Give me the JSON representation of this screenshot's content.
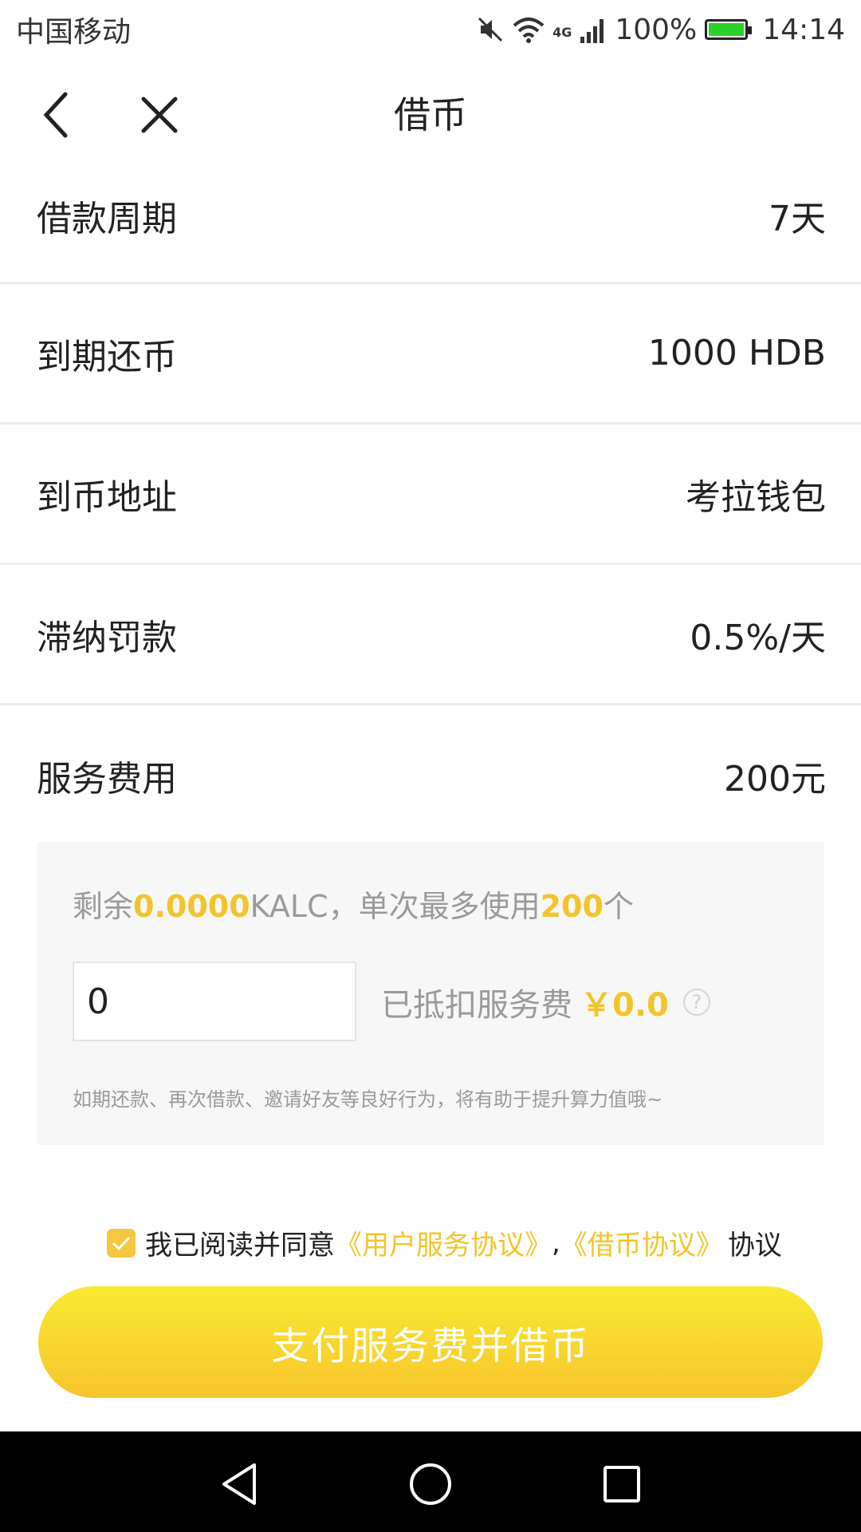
{
  "status_bar": {
    "carrier": "中国移动",
    "network": "4G",
    "battery": "100%",
    "time": "14:14",
    "icons": [
      "mute-icon",
      "wifi-icon",
      "signal-icon",
      "battery-icon"
    ],
    "battery_color": "#2bd12b"
  },
  "nav": {
    "title": "借币",
    "icons": [
      "back-icon",
      "close-icon"
    ]
  },
  "rows": [
    {
      "label": "借款周期",
      "value": "7天"
    },
    {
      "label": "到期还币",
      "value": "1000 HDB"
    },
    {
      "label": "到币地址",
      "value": "考拉钱包"
    },
    {
      "label": "滞纳罚款",
      "value": "0.5%/天"
    },
    {
      "label": "服务费用",
      "value": "200元"
    }
  ],
  "panel": {
    "remaining_prefix": "剩余",
    "remaining_amount": "0.0000",
    "remaining_mid": "KALC，单次最多使用",
    "max_use": "200",
    "remaining_suffix": "个",
    "input_value": "0",
    "deduct_label": "已抵扣服务费",
    "deduct_amount": "￥0.0",
    "help_symbol": "?",
    "note": "如期还款、再次借款、邀请好友等良好行为，将有助于提升算力值哦~"
  },
  "agreement": {
    "prefix": "我已阅读并同意",
    "link1": "《用户服务协议》",
    "separator": ",",
    "link2": "《借币协议》",
    "suffix": "协议"
  },
  "pay_button": {
    "label": "支付服务费并借币"
  },
  "system_nav": {
    "icons": [
      "back-triangle-icon",
      "home-circle-icon",
      "recents-square-icon"
    ]
  },
  "colors": {
    "accent": "#f3c42a",
    "button_top": "#f9ea33",
    "button_bottom": "#f6c52c",
    "panel_bg": "#f7f7f7"
  }
}
